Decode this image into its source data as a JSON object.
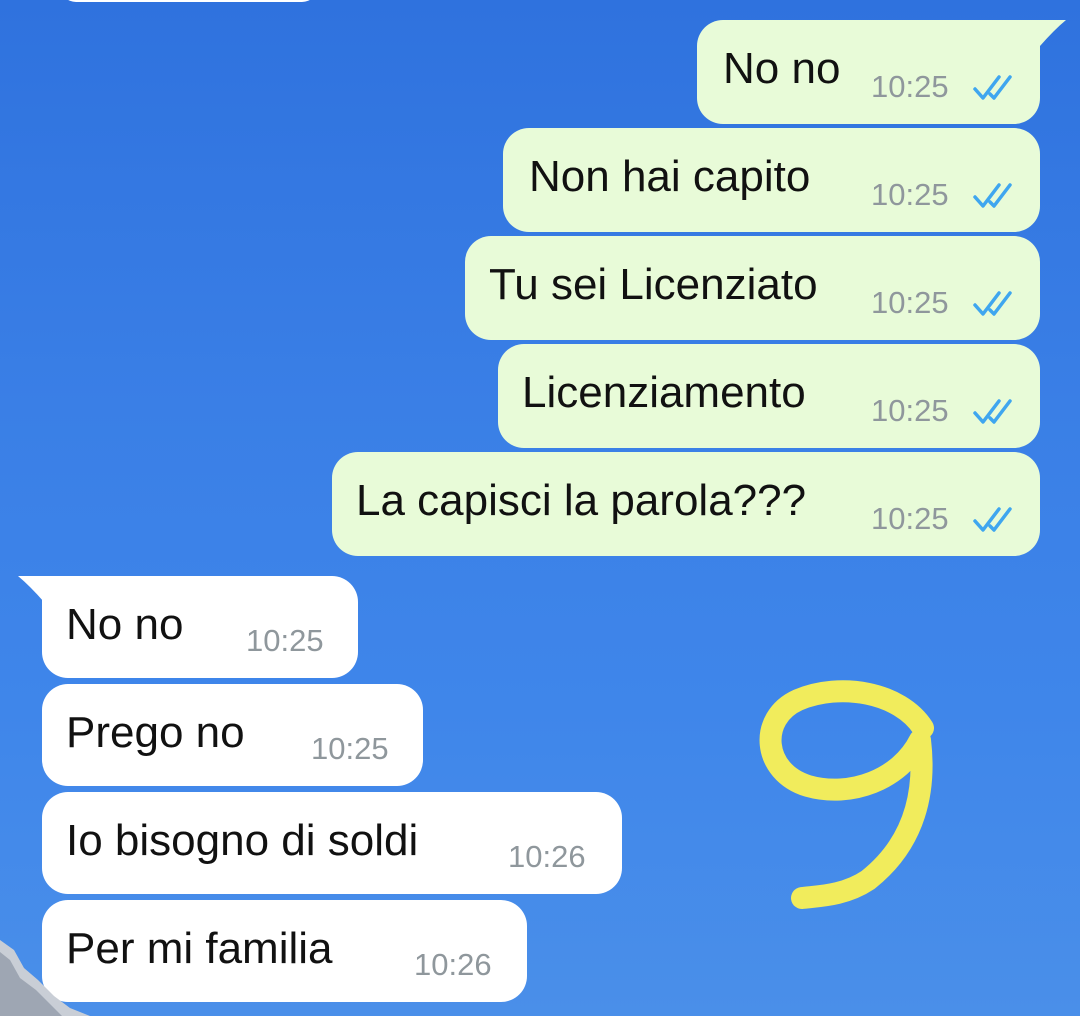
{
  "colors": {
    "background": "#3a7fe6",
    "outgoing_bubble": "#e8fbd8",
    "incoming_bubble": "#ffffff",
    "timestamp": "#8f979c",
    "read_ticks": "#3fa6ef",
    "doodle": "#f1ec5c"
  },
  "icons": {
    "read_receipt": "double-check-icon",
    "doodle": "handwritten-nine"
  },
  "messages": {
    "outgoing": [
      {
        "text": "No no",
        "time": "10:25"
      },
      {
        "text": "Non hai capito",
        "time": "10:25"
      },
      {
        "text": "Tu sei Licenziato",
        "time": "10:25"
      },
      {
        "text": "Licenziamento",
        "time": "10:25"
      },
      {
        "text": "La capisci la parola???",
        "time": "10:25"
      }
    ],
    "incoming": [
      {
        "text": "No no",
        "time": "10:25"
      },
      {
        "text": "Prego no",
        "time": "10:25"
      },
      {
        "text": "Io bisogno di soldi",
        "time": "10:26"
      },
      {
        "text": "Per mi familia",
        "time": "10:26"
      }
    ]
  }
}
